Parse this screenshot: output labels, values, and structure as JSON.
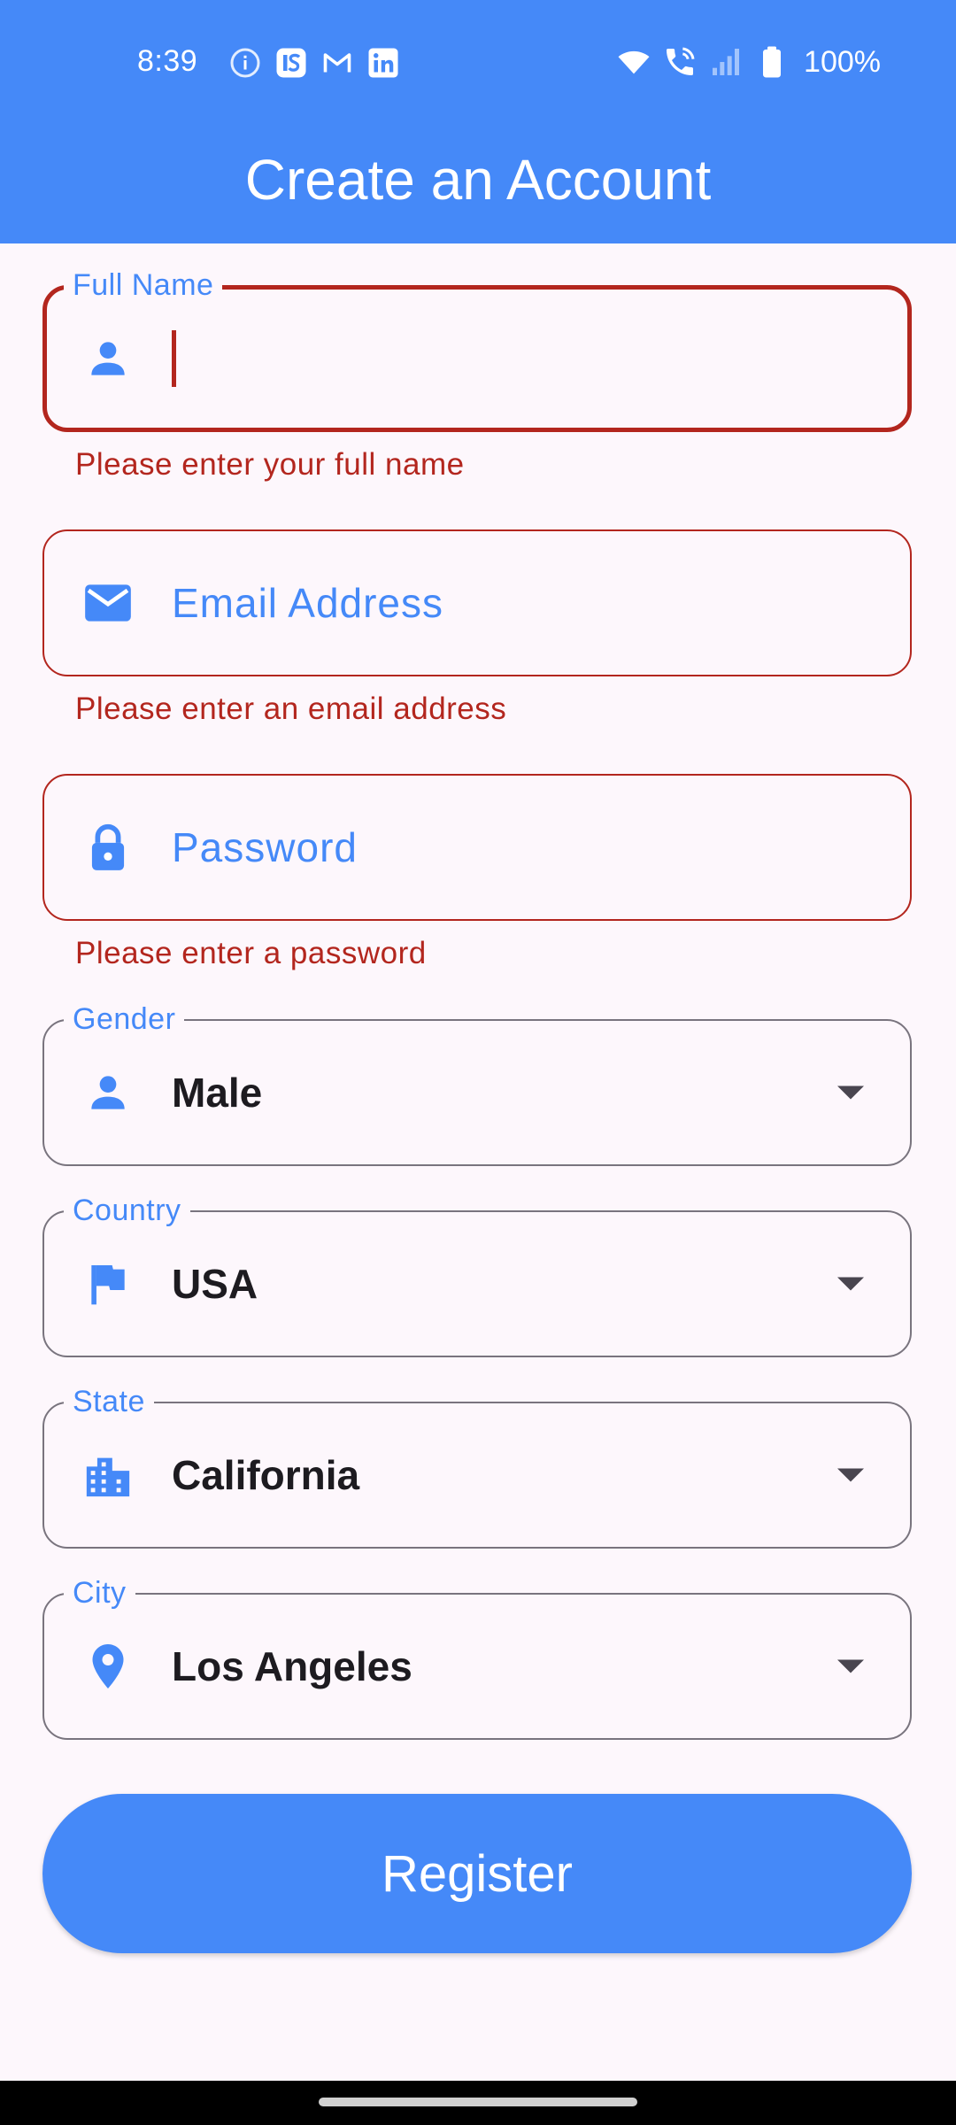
{
  "status_bar": {
    "time": "8:39",
    "battery_percent": "100%",
    "notification_icons": [
      "info-icon",
      "indeed-icon",
      "gmail-icon",
      "linkedin-icon"
    ],
    "system_icons": [
      "wifi-icon",
      "wifi-calling-icon",
      "signal-icon",
      "battery-icon"
    ]
  },
  "app_bar": {
    "title": "Create an Account"
  },
  "form": {
    "full_name": {
      "label": "Full Name",
      "value": "",
      "error": "Please enter your full name",
      "icon": "person-icon"
    },
    "email": {
      "placeholder": "Email Address",
      "error": "Please enter an email address",
      "icon": "email-icon"
    },
    "password": {
      "placeholder": "Password",
      "error": "Please enter a password",
      "icon": "lock-icon"
    },
    "gender": {
      "label": "Gender",
      "value": "Male",
      "icon": "person-icon"
    },
    "country": {
      "label": "Country",
      "value": "USA",
      "icon": "flag-icon"
    },
    "state": {
      "label": "State",
      "value": "California",
      "icon": "building-icon"
    },
    "city": {
      "label": "City",
      "value": "Los Angeles",
      "icon": "location-pin-icon"
    }
  },
  "register_button": {
    "label": "Register"
  },
  "colors": {
    "primary": "#4589f8",
    "error": "#b3261e",
    "outline": "#79747e",
    "background": "#fdf7fc",
    "text": "#1d1b20"
  }
}
